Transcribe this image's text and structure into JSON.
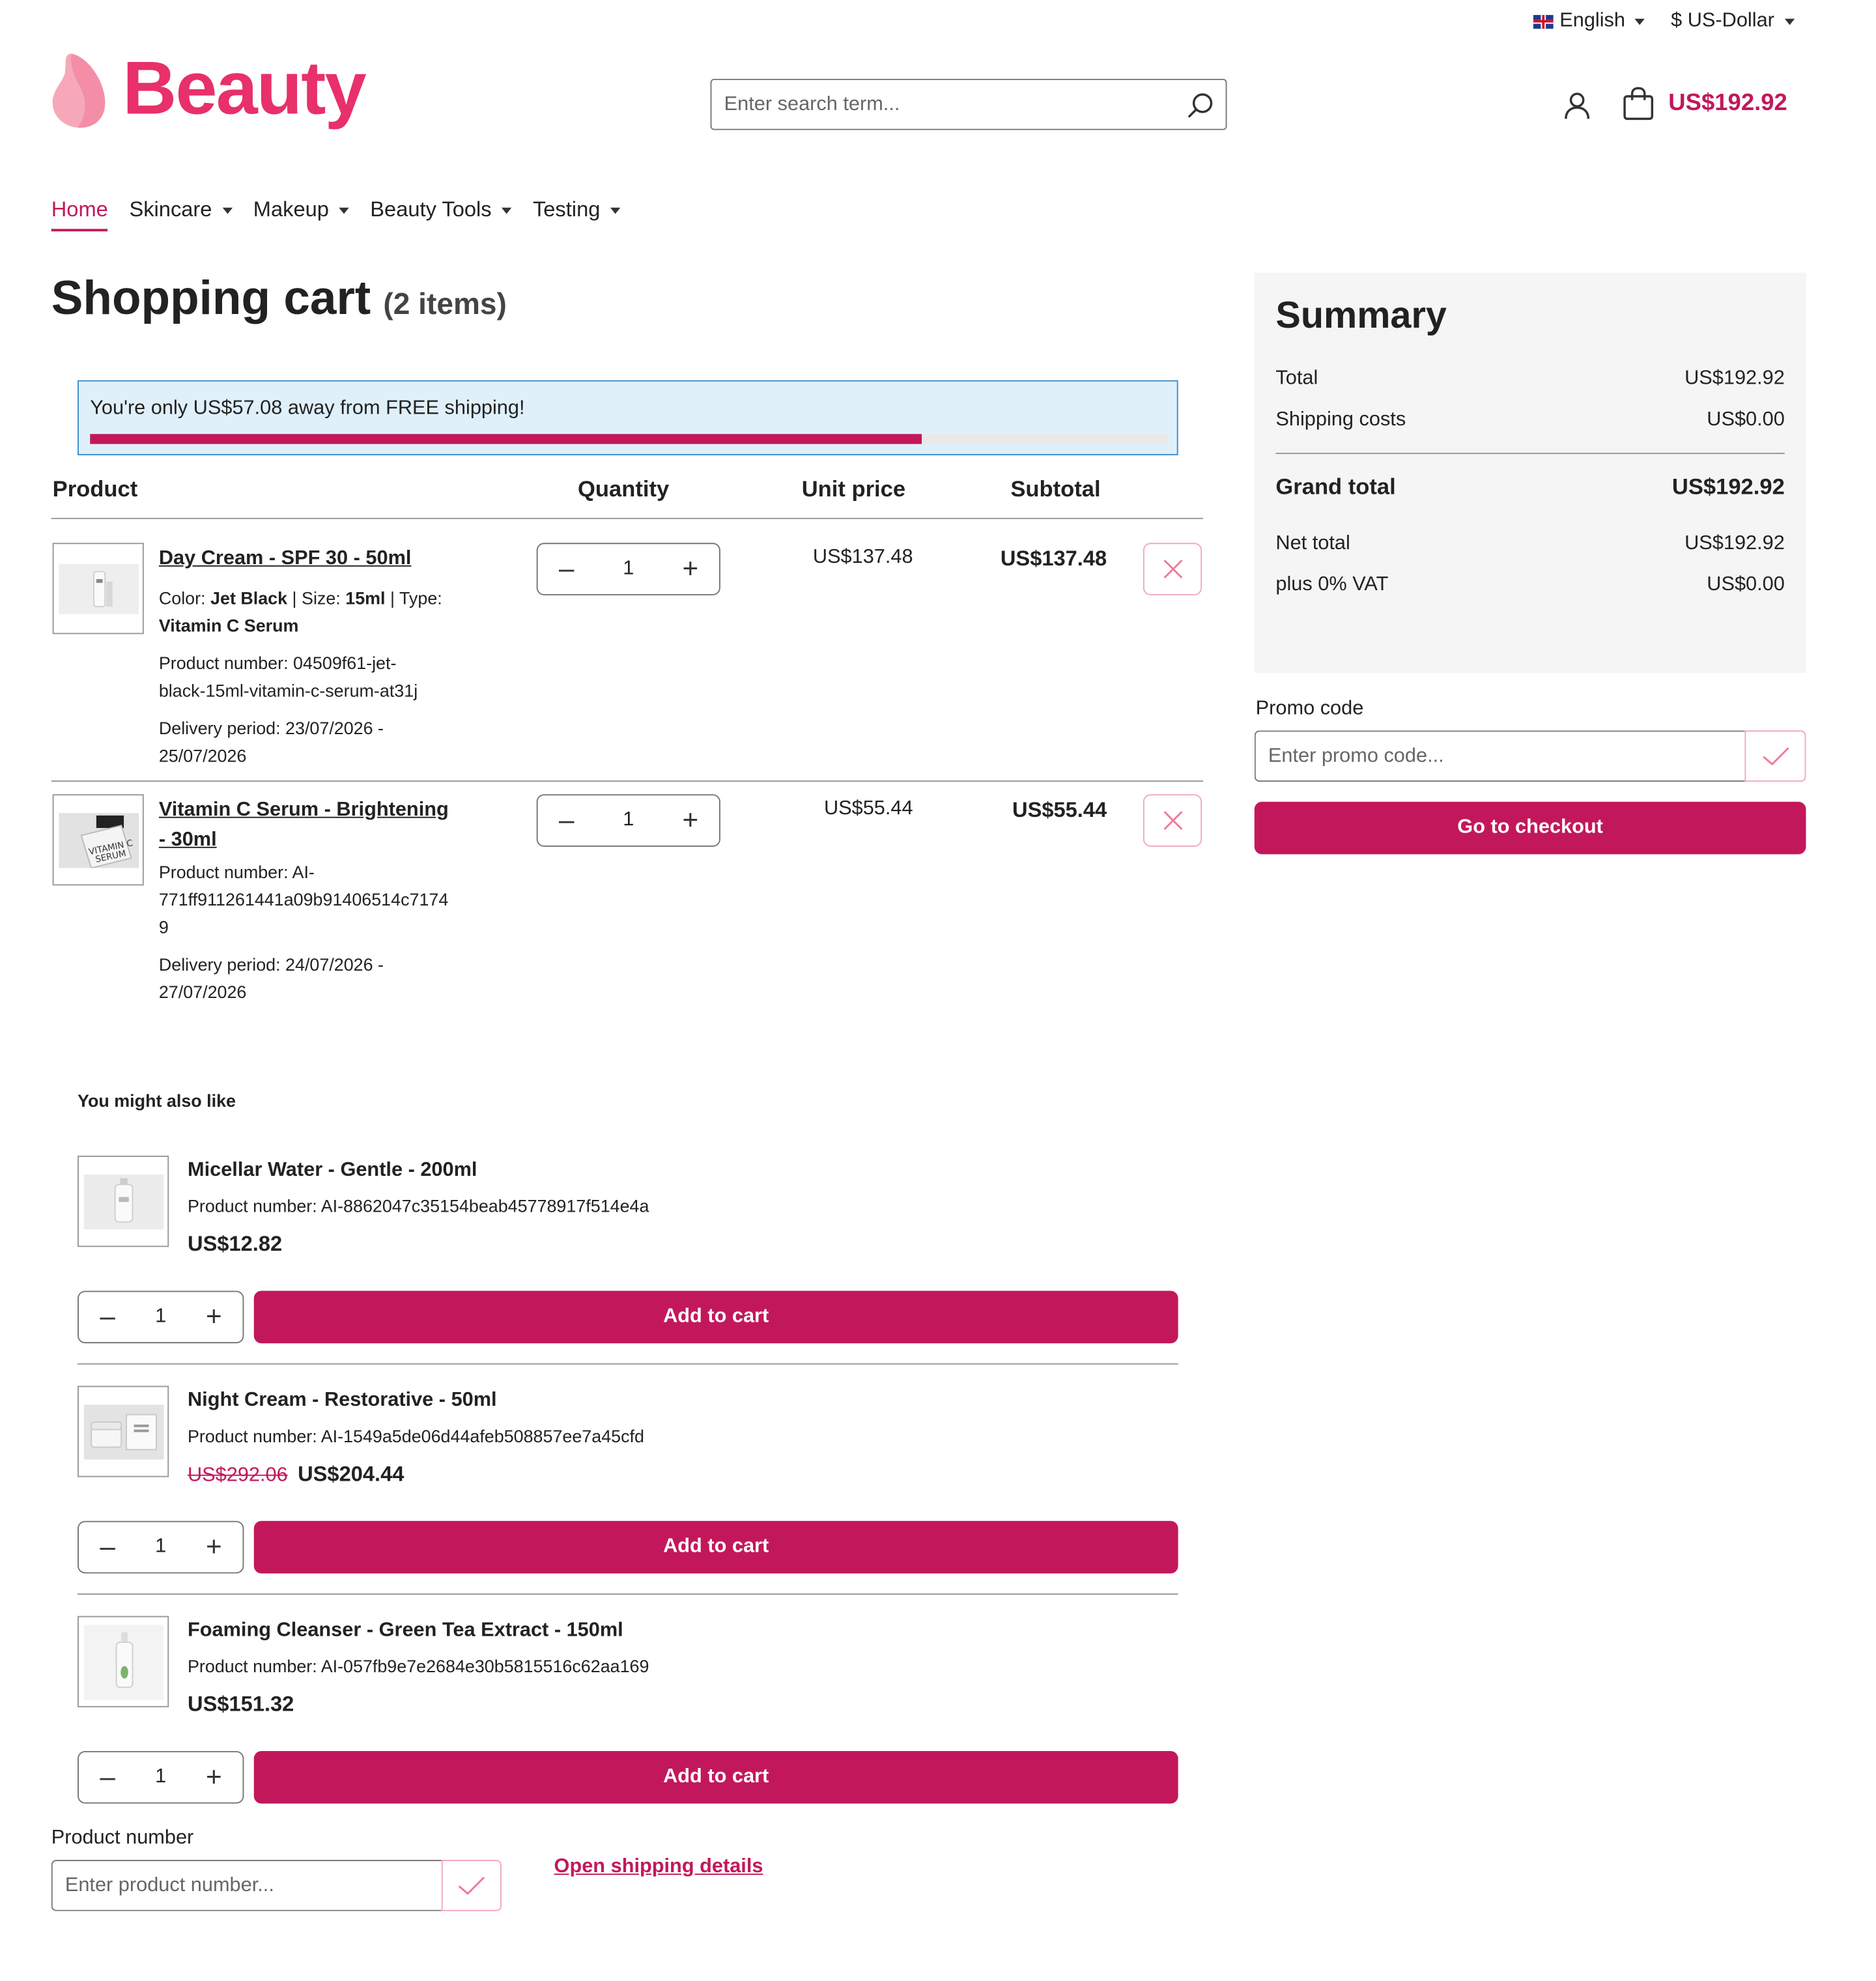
{
  "topbar": {
    "language": "English",
    "currency": "$ US-Dollar"
  },
  "header": {
    "brand": "Beauty",
    "search_placeholder": "Enter search term...",
    "cart_total": "US$192.92"
  },
  "nav": {
    "items": [
      "Home",
      "Skincare",
      "Makeup",
      "Beauty Tools",
      "Testing"
    ]
  },
  "cart": {
    "title": "Shopping cart",
    "count": "(2 items)",
    "shipping_message": "You're only US$57.08 away from FREE shipping!",
    "shipping_progress": 0.771,
    "columns": {
      "product": "Product",
      "quantity": "Quantity",
      "unit_price": "Unit price",
      "subtotal": "Subtotal"
    },
    "items": [
      {
        "name": "Day Cream - SPF 30 - 50ml",
        "attr_color_label": "Color:",
        "attr_color_value": "Jet Black",
        "attr_size_label": "Size:",
        "attr_size_value": "15ml",
        "attr_type_label": "Type:",
        "attr_type_value": "Vitamin C Serum",
        "product_number_line1": "Product number: 04509f61-jet-",
        "product_number_line2": "black-15ml-vitamin-c-serum-at31j",
        "delivery_line1": "Delivery period: 23/07/2026 -",
        "delivery_line2": "25/07/2026",
        "quantity": "1",
        "unit_price": "US$137.48",
        "subtotal": "US$137.48"
      },
      {
        "name_line1": "Vitamin C Serum - Brightening",
        "name_line2": "- 30ml",
        "product_number_line1": "Product number: AI-",
        "product_number_line2": "771ff911261441a09b91406514c7174",
        "product_number_line3": "9",
        "delivery_line1": "Delivery period: 24/07/2026 -",
        "delivery_line2": "27/07/2026",
        "quantity": "1",
        "unit_price": "US$55.44",
        "subtotal": "US$55.44"
      }
    ]
  },
  "summary": {
    "title": "Summary",
    "total_label": "Total",
    "total_value": "US$192.92",
    "shipping_label": "Shipping costs",
    "shipping_value": "US$0.00",
    "grand_label": "Grand total",
    "grand_value": "US$192.92",
    "net_label": "Net total",
    "net_value": "US$192.92",
    "vat_label": "plus 0% VAT",
    "vat_value": "US$0.00"
  },
  "promo": {
    "label": "Promo code",
    "placeholder": "Enter promo code...",
    "checkout_label": "Go to checkout"
  },
  "recommendations": {
    "title": "You might also like",
    "add_label": "Add to cart",
    "items": [
      {
        "name": "Micellar Water - Gentle - 200ml",
        "number": "Product number: AI-8862047c35154beab45778917f514e4a",
        "old_price": "",
        "price": "US$12.82",
        "quantity": "1"
      },
      {
        "name": "Night Cream - Restorative - 50ml",
        "number": "Product number: AI-1549a5de06d44afeb508857ee7a45cfd",
        "old_price": "US$292.06",
        "price": "US$204.44",
        "quantity": "1"
      },
      {
        "name": "Foaming Cleanser - Green Tea Extract - 150ml",
        "number": "Product number: AI-057fb9e7e2684e30b5815516c62aa169",
        "old_price": "",
        "price": "US$151.32",
        "quantity": "1"
      }
    ]
  },
  "product_number_field": {
    "label": "Product number",
    "placeholder": "Enter product number..."
  },
  "shipping_details_link": "Open shipping details",
  "colors": {
    "brand": "#e8306a",
    "accent": "#c2185b"
  }
}
